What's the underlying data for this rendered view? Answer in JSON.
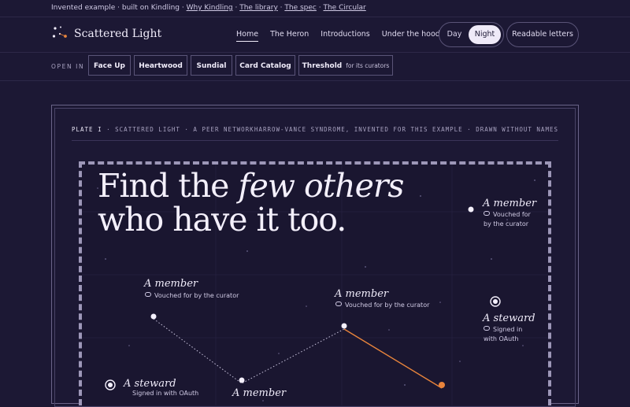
{
  "topstrip": {
    "prefix": "Invented example · built on Kindling ·",
    "links": [
      "Why Kindling",
      "The library",
      "The spec",
      "The Circular"
    ]
  },
  "brand": {
    "name": "Scattered Light",
    "icon": "constellation-icon"
  },
  "nav": {
    "items": [
      "Home",
      "The Heron",
      "Introductions",
      "Under the hood"
    ],
    "active": "Home",
    "theme": {
      "day": "Day",
      "night": "Night",
      "selected": "Night"
    },
    "readable": "Readable letters"
  },
  "openin": {
    "label": "OPEN IN",
    "chips": [
      {
        "label": "Face Up"
      },
      {
        "label": "Heartwood"
      },
      {
        "label": "Sundial"
      },
      {
        "label": "Card Catalog"
      },
      {
        "label": "Threshold",
        "note": "for its curators"
      }
    ]
  },
  "plate": {
    "number": "PLATE I",
    "left": "· SCATTERED LIGHT · A PEER NETWORK",
    "right": "HARROW-VANCE SYNDROME, INVENTED FOR THIS EXAMPLE · DRAWN WITHOUT NAMES"
  },
  "heading": {
    "part1": "Find the ",
    "italic": "few others",
    "line2": "who have it too."
  },
  "nodes": [
    {
      "title": "A member",
      "sub": "Vouched for",
      "sub2": "by the curator"
    },
    {
      "title": "A member",
      "sub": "Vouched for by the curator"
    },
    {
      "title": "A member",
      "sub": "Vouched for by the curator"
    },
    {
      "title": "A steward",
      "sub": "Signed in",
      "sub2": "with OAuth"
    },
    {
      "title": "A steward",
      "sub": "Signed in with OAuth"
    },
    {
      "title": "A member"
    }
  ],
  "colors": {
    "background": "#1c1834",
    "accent": "#e8843c",
    "text": "#e8e4f4"
  }
}
